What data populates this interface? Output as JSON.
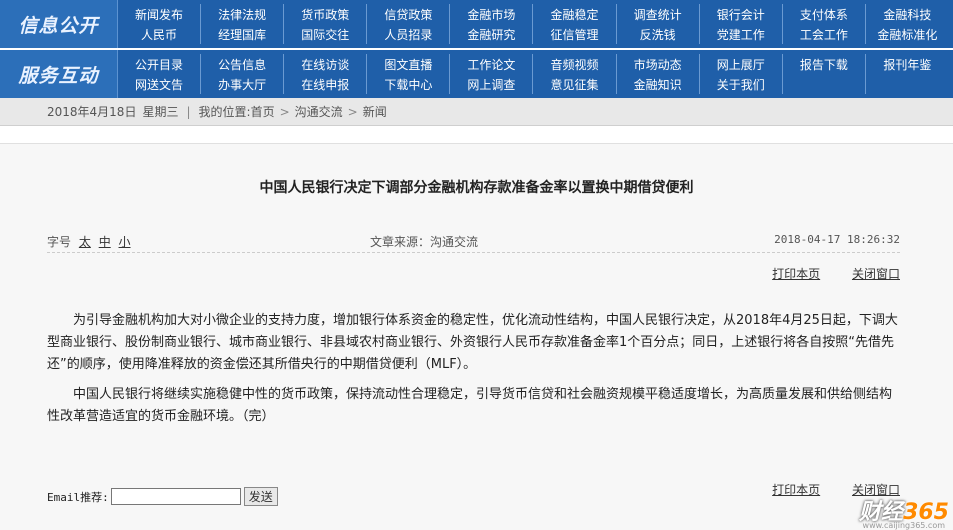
{
  "nav": {
    "info_title": "信息公开",
    "info_row1": [
      "新闻发布",
      "法律法规",
      "货币政策",
      "信贷政策",
      "金融市场",
      "金融稳定",
      "调查统计",
      "银行会计",
      "支付体系",
      "金融科技"
    ],
    "info_row2": [
      "人民币",
      "经理国库",
      "国际交往",
      "人员招录",
      "金融研究",
      "征信管理",
      "反洗钱",
      "党建工作",
      "工会工作",
      "金融标准化"
    ],
    "service_title": "服务互动",
    "service_row1": [
      "公开目录",
      "公告信息",
      "在线访谈",
      "图文直播",
      "工作论文",
      "音频视频",
      "市场动态",
      "网上展厅",
      "报告下载",
      "报刊年鉴"
    ],
    "service_row2": [
      "网送文告",
      "办事大厅",
      "在线申报",
      "下载中心",
      "网上调查",
      "意见征集",
      "金融知识",
      "关于我们",
      "",
      ""
    ]
  },
  "breadcrumb": {
    "date": "2018年4月18日",
    "weekday": "星期三",
    "location_label": "我的位置:",
    "items": [
      "首页",
      "沟通交流",
      "新闻"
    ]
  },
  "article": {
    "title": "中国人民银行决定下调部分金融机构存款准备金率以置换中期借贷便利",
    "font_size_label": "字号",
    "font_sizes": [
      "太",
      "中",
      "小"
    ],
    "source": "文章来源：沟通交流",
    "datetime": "2018-04-17 18:26:32",
    "print_label": "打印本页",
    "close_label": "关闭窗口",
    "paragraphs": [
      "为引导金融机构加大对小微企业的支持力度，增加银行体系资金的稳定性，优化流动性结构，中国人民银行决定，从2018年4月25日起，下调大型商业银行、股份制商业银行、城市商业银行、非县域农村商业银行、外资银行人民币存款准备金率1个百分点；同日，上述银行将各自按照“先借先还”的顺序，使用降准释放的资金偿还其所借央行的中期借贷便利（MLF）。",
      "中国人民银行将继续实施稳健中性的货币政策，保持流动性合理稳定，引导货币信贷和社会融资规模平稳适度增长，为高质量发展和供给侧结构性改革营造适宜的货币金融环境。（完）"
    ]
  },
  "email": {
    "label": "Email推荐:",
    "input_value": "",
    "send_label": "发送"
  },
  "watermark": {
    "brand": "财经",
    "number": "365",
    "url": "www.caijing365.com"
  }
}
